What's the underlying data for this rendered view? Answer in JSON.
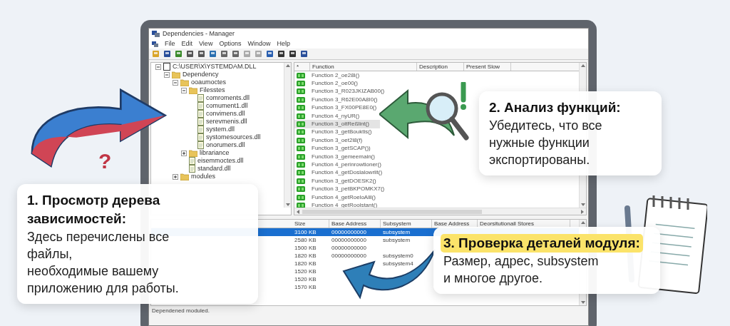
{
  "window": {
    "title": "Dependencies - Manager"
  },
  "menu": [
    "File",
    "Edit",
    "View",
    "Options",
    "Window",
    "Help"
  ],
  "tree": [
    {
      "label": "C:\\USER\\X\\YSTEMDAM.DLL",
      "kind": "root",
      "expanded": true,
      "children": [
        {
          "label": "Dependency",
          "kind": "folder",
          "expanded": true,
          "children": [
            {
              "label": "ooaumoctes",
              "kind": "folder",
              "expanded": true,
              "children": [
                {
                  "label": "Filesstes",
                  "kind": "folder",
                  "expanded": true,
                  "children": [
                    {
                      "label": "comroments.dll",
                      "kind": "file"
                    },
                    {
                      "label": "comument1.dll",
                      "kind": "file"
                    },
                    {
                      "label": "convimens.dll",
                      "kind": "file"
                    },
                    {
                      "label": "serevmenis.dll",
                      "kind": "file"
                    },
                    {
                      "label": "system.dll",
                      "kind": "file"
                    },
                    {
                      "label": "systomesources.dll",
                      "kind": "file"
                    },
                    {
                      "label": "onorumers.dll",
                      "kind": "file"
                    }
                  ]
                },
                {
                  "label": "librariance",
                  "kind": "folder",
                  "expanded": false
                },
                {
                  "label": "eisemmoctes.dll",
                  "kind": "file"
                },
                {
                  "label": "standard.dll",
                  "kind": "file"
                }
              ]
            },
            {
              "label": "modules",
              "kind": "folder",
              "expanded": false
            }
          ]
        }
      ]
    }
  ],
  "functions": {
    "columns": [
      "*",
      "Function",
      "Description",
      "Present Slow"
    ],
    "rows": [
      {
        "name": "Function 2_oe28I()",
        "selected": false
      },
      {
        "name": "Function 2_oe00()",
        "selected": false
      },
      {
        "name": "Function 3_R023JKIZAB00()",
        "selected": false
      },
      {
        "name": "Function 3_R62E00A8I0()",
        "selected": false
      },
      {
        "name": "Function 3_FX00PE8E0()",
        "selected": false
      },
      {
        "name": "Function 4_nyUR()",
        "selected": false
      },
      {
        "name": "Function 3_oitReßlint()",
        "selected": true
      },
      {
        "name": "Function 3_getBouktis()",
        "selected": false
      },
      {
        "name": "Function 3_oet2l8(f)",
        "selected": false
      },
      {
        "name": "Function 3_getSCAP())",
        "selected": false
      },
      {
        "name": "Function 3_gemeemain()",
        "selected": false
      },
      {
        "name": "Function 4_perinrowtioner()",
        "selected": false
      },
      {
        "name": "Function 4_getDoslalowriit()",
        "selected": false
      },
      {
        "name": "Function 3_getDOESK2()",
        "selected": false
      },
      {
        "name": "Function 3_petBKPOMKX7()",
        "selected": false
      },
      {
        "name": "Function 4_getRoeloAlil()",
        "selected": false
      },
      {
        "name": "Function 4_getRoolstant()",
        "selected": false
      }
    ]
  },
  "modules": {
    "columns": [
      "Size",
      "Base Address",
      "Subsystem",
      "Base Address",
      "Deorsitutionall Stores"
    ],
    "rows": [
      {
        "size": "3100 KB",
        "base_address": "00000000000",
        "subsystem": "subsystem",
        "selected": true
      },
      {
        "size": "2580 KB",
        "base_address": "00000000000",
        "subsystem": "subsystem",
        "selected": false
      },
      {
        "size": "1500 KB",
        "base_address": "00000000000",
        "selected": false
      },
      {
        "size": "1820 KB",
        "base_address": "00000000000",
        "subsystem": "subsystem0",
        "selected": false
      },
      {
        "size": "1820 KB",
        "subsystem": "subsystem4",
        "selected": false
      },
      {
        "size": "1520 KB",
        "selected": false
      },
      {
        "size": "1520 KB",
        "selected": false
      },
      {
        "size": "1570 KB",
        "selected": false
      }
    ]
  },
  "status_bar": "Dependened moduled.",
  "decoration_mark": "?",
  "callouts": [
    {
      "title": "1. Просмотр дерева зависимостей:",
      "body_lines": [
        "Здесь перечислены все",
        "файлы,",
        "необходимые вашему",
        "приложению для работы."
      ],
      "highlighted": false
    },
    {
      "title": "2. Анализ функций:",
      "body_lines": [
        "Убедитесь, что все",
        "нужные функции",
        "экспортированы."
      ],
      "highlighted": false
    },
    {
      "title": "3. Проверка деталей модуля:",
      "body_lines": [
        "Размер, адрес, subsystem",
        "и многое другое."
      ],
      "highlighted": true
    }
  ]
}
